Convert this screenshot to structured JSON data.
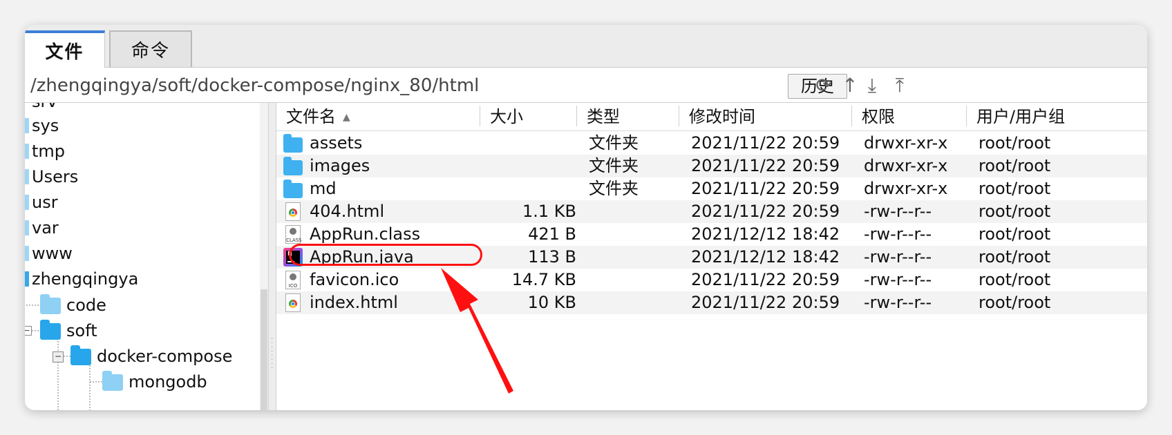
{
  "tabs": [
    {
      "label": "文件",
      "active": true
    },
    {
      "label": "命令",
      "active": false
    }
  ],
  "path": {
    "value": "/zhengqingya/soft/docker-compose/nginx_80/html",
    "history_label": "历史"
  },
  "toolbar_icons": [
    "refresh-icon",
    "upload-arrow-icon",
    "download-icon",
    "upload-icon"
  ],
  "tree": {
    "items": [
      {
        "label": "srv"
      },
      {
        "label": "sys"
      },
      {
        "label": "tmp"
      },
      {
        "label": "Users"
      },
      {
        "label": "usr"
      },
      {
        "label": "var"
      },
      {
        "label": "www"
      },
      {
        "label": "zhengqingya"
      },
      {
        "label": "code"
      },
      {
        "label": "soft"
      },
      {
        "label": "docker-compose"
      },
      {
        "label": "mongodb"
      }
    ]
  },
  "columns": [
    "文件名",
    "大小",
    "类型",
    "修改时间",
    "权限",
    "用户/用户组"
  ],
  "files": [
    {
      "name": "assets",
      "size": "",
      "type": "文件夹",
      "modified": "2021/11/22 20:59",
      "perm": "drwxr-xr-x",
      "owner": "root/root",
      "icon": "folder-icon"
    },
    {
      "name": "images",
      "size": "",
      "type": "文件夹",
      "modified": "2021/11/22 20:59",
      "perm": "drwxr-xr-x",
      "owner": "root/root",
      "icon": "folder-icon"
    },
    {
      "name": "md",
      "size": "",
      "type": "文件夹",
      "modified": "2021/11/22 20:59",
      "perm": "drwxr-xr-x",
      "owner": "root/root",
      "icon": "folder-icon"
    },
    {
      "name": "404.html",
      "size": "1.1 KB",
      "type": "",
      "modified": "2021/11/22 20:59",
      "perm": "-rw-r--r--",
      "owner": "root/root",
      "icon": "chrome-html-icon"
    },
    {
      "name": "AppRun.class",
      "size": "421 B",
      "type": "",
      "modified": "2021/12/12 18:42",
      "perm": "-rw-r--r--",
      "owner": "root/root",
      "icon": "class-file-icon"
    },
    {
      "name": "AppRun.java",
      "size": "113 B",
      "type": "",
      "modified": "2021/12/12 18:42",
      "perm": "-rw-r--r--",
      "owner": "root/root",
      "icon": "intellij-icon"
    },
    {
      "name": "favicon.ico",
      "size": "14.7 KB",
      "type": "",
      "modified": "2021/11/22 20:59",
      "perm": "-rw-r--r--",
      "owner": "root/root",
      "icon": "ico-file-icon"
    },
    {
      "name": "index.html",
      "size": "10 KB",
      "type": "",
      "modified": "2021/11/22 20:59",
      "perm": "-rw-r--r--",
      "owner": "root/root",
      "icon": "chrome-html-icon"
    }
  ],
  "icon_labels": {
    "class": "CLASS",
    "ico": "ICO",
    "ij": "IJ"
  },
  "colors": {
    "accent": "#3b7ed8",
    "folder": "#40b1f0",
    "highlight": "#ff1010"
  }
}
